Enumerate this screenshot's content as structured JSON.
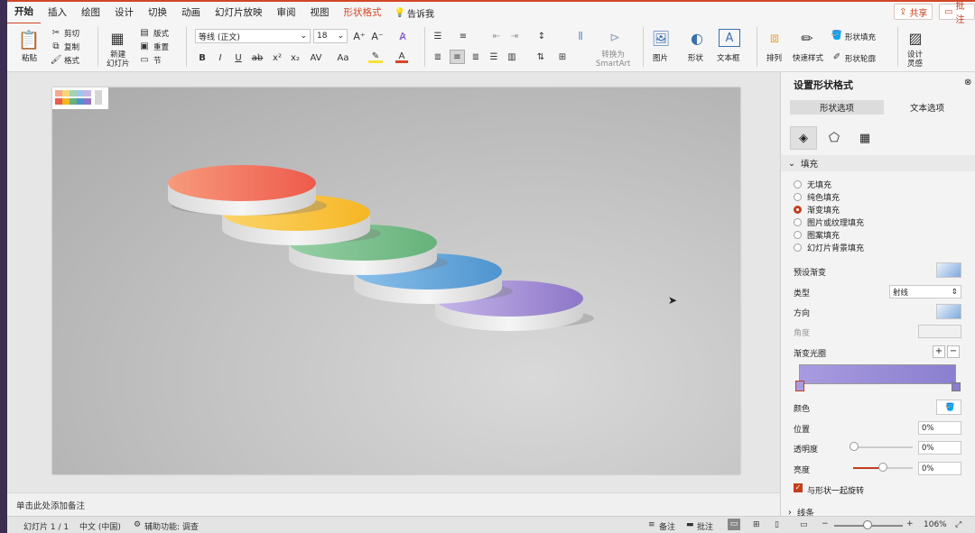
{
  "menu": {
    "tabs": [
      "开始",
      "插入",
      "绘图",
      "设计",
      "切换",
      "动画",
      "幻灯片放映",
      "审阅",
      "视图",
      "形状格式"
    ],
    "tell_me": "告诉我",
    "share": "共享",
    "comments": "批注"
  },
  "ribbon": {
    "paste": "粘贴",
    "cut": "剪切",
    "copy": "复制",
    "format": "格式",
    "new_slide": "新建\n幻灯片",
    "layout": "版式",
    "reset": "重置",
    "section": "节",
    "font_name": "等线 (正文)",
    "font_size": "18",
    "smartart": "转换为\nSmartArt",
    "picture": "图片",
    "shape": "形状",
    "textbox": "文本框",
    "arrange": "排列",
    "quick_styles": "快速样式",
    "shape_fill": "形状填充",
    "shape_outline": "形状轮廓",
    "designer": "设计\n灵感"
  },
  "pane": {
    "title": "设置形状格式",
    "tab_shape": "形状选项",
    "tab_text": "文本选项",
    "fill_header": "填充",
    "fill_options": [
      "无填充",
      "纯色填充",
      "渐变填充",
      "图片或纹理填充",
      "图案填充",
      "幻灯片背景填充"
    ],
    "selected_fill": "渐变填充",
    "preset_label": "预设渐变",
    "type_label": "类型",
    "type_value": "射线",
    "direction_label": "方向",
    "angle_label": "角度",
    "stops_label": "渐变光圈",
    "color_label": "颜色",
    "position_label": "位置",
    "position_value": "0%",
    "transparency_label": "透明度",
    "transparency_value": "0%",
    "brightness_label": "亮度",
    "brightness_value": "0%",
    "rotate_label": "与形状一起旋转",
    "line_header": "线条",
    "accent": "#c43e1c",
    "gradient_from": "#a99be0",
    "gradient_to": "#8a7fcf"
  },
  "notes": "单击此处添加备注",
  "status": {
    "slide": "幻灯片 1 / 1",
    "lang": "中文 (中国)",
    "accessibility": "辅助功能: 调查",
    "notes_btn": "备注",
    "comments_btn": "批注",
    "zoom": "106%"
  },
  "slide_colors": {
    "disc1": "#f2715a",
    "disc2": "#f8c23b",
    "disc3": "#7bbf8f",
    "disc4": "#6aa9db",
    "disc5": "#a48ed4"
  }
}
